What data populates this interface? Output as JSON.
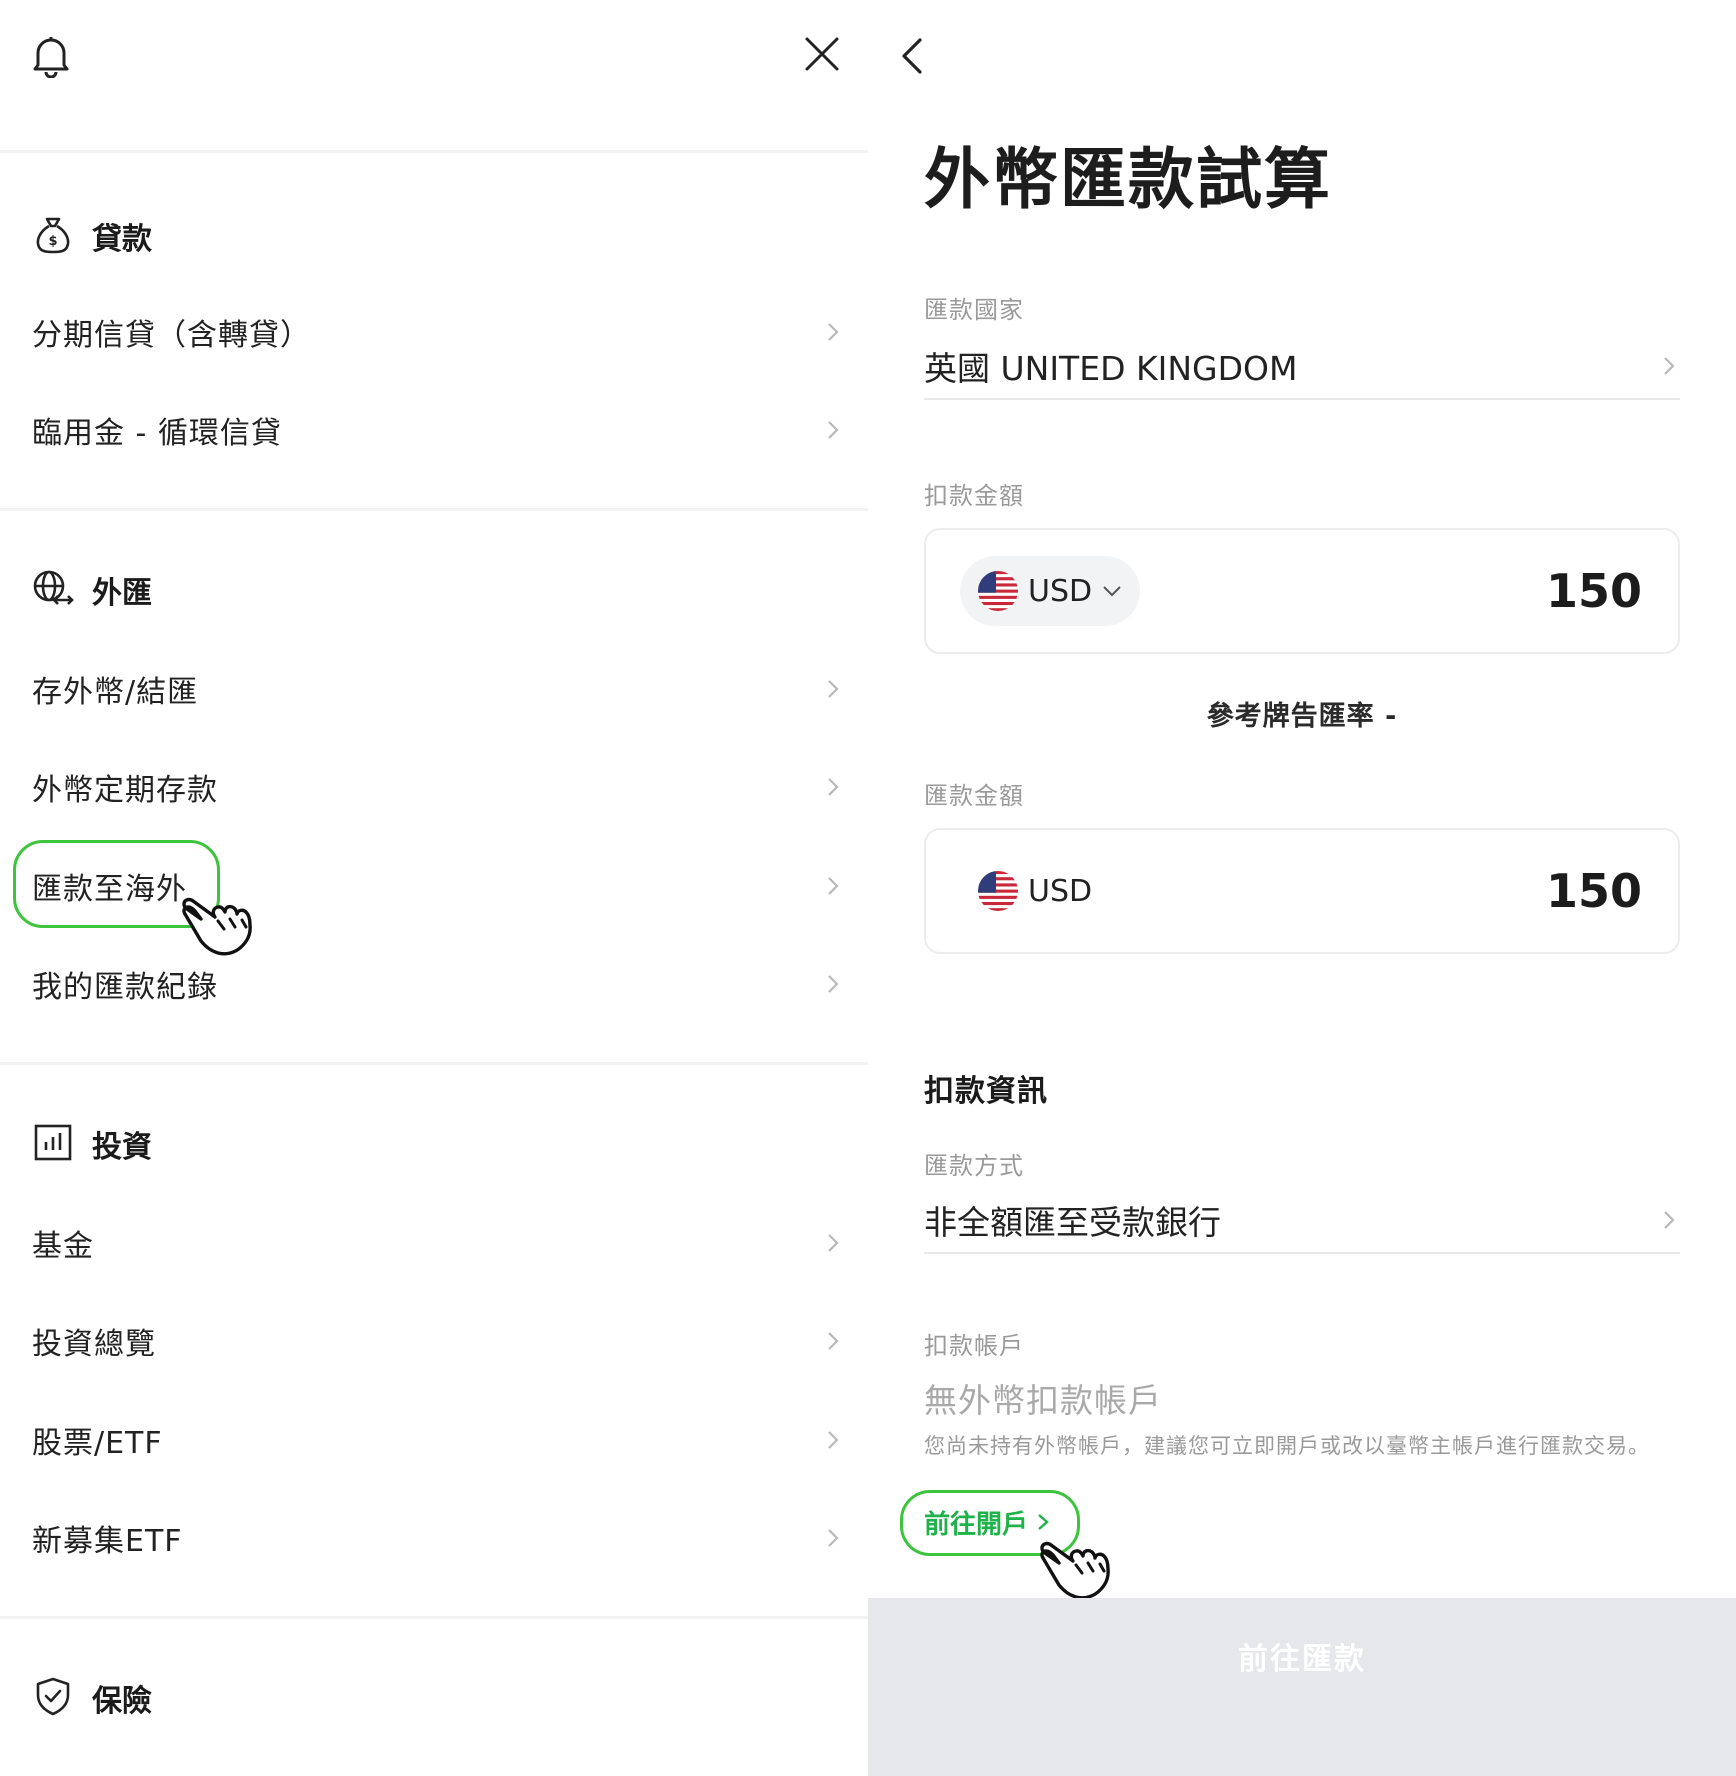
{
  "menu": {
    "sections": [
      {
        "title": "貸款",
        "icon": "money-bag-icon",
        "items": [
          {
            "label": "分期信貸（含轉貸）"
          },
          {
            "label": "臨用金 - 循環信貸"
          }
        ]
      },
      {
        "title": "外匯",
        "icon": "globe-exchange-icon",
        "items": [
          {
            "label": "存外幣/結匯"
          },
          {
            "label": "外幣定期存款"
          },
          {
            "label": "匯款至海外"
          },
          {
            "label": "我的匯款紀錄"
          }
        ]
      },
      {
        "title": "投資",
        "icon": "bar-chart-icon",
        "items": [
          {
            "label": "基金"
          },
          {
            "label": "投資總覽"
          },
          {
            "label": "股票/ETF"
          },
          {
            "label": "新募集ETF"
          }
        ]
      },
      {
        "title": "保險",
        "icon": "shield-icon",
        "items": []
      }
    ]
  },
  "calculator": {
    "title": "外幣匯款試算",
    "country": {
      "label": "匯款國家",
      "value": "英國 UNITED KINGDOM"
    },
    "debit": {
      "label": "扣款金額",
      "currency": "USD",
      "amount": "150"
    },
    "rate_text": "參考牌告匯率 -",
    "remit": {
      "label": "匯款金額",
      "currency": "USD",
      "amount": "150"
    },
    "debit_info": {
      "heading": "扣款資訊",
      "method_label": "匯款方式",
      "method_value": "非全額匯至受款銀行",
      "account_label": "扣款帳戶",
      "account_value": "無外幣扣款帳戶",
      "note": "您尚未持有外幣帳戶，建議您可立即開戶或改以臺幣主帳戶進行匯款交易。",
      "open_link": "前往開戶"
    },
    "submit_label": "前往匯款"
  },
  "colors": {
    "accent_green": "#1fb14a",
    "highlight_green": "#3cc43c",
    "disabled_button": "#e5e7eb"
  }
}
